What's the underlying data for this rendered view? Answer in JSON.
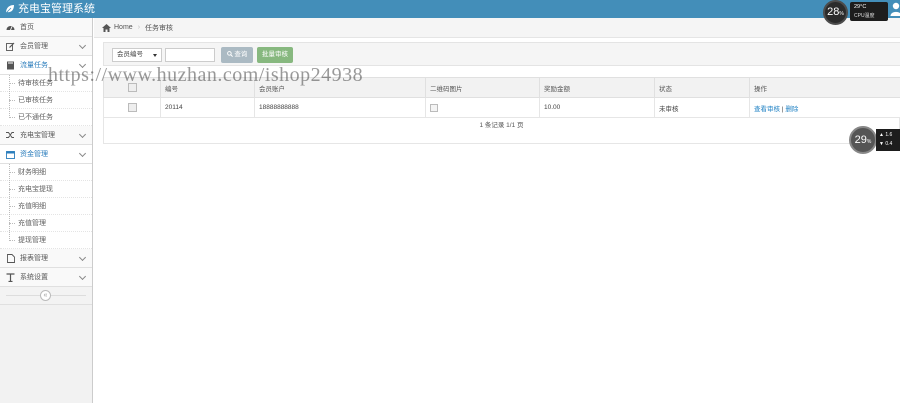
{
  "app": {
    "title": "充电宝管理系统"
  },
  "sidebar": {
    "items": [
      {
        "label": "首页",
        "icon": "tachometer-icon"
      },
      {
        "label": "会员管理",
        "icon": "edit-icon"
      },
      {
        "label": "流量任务",
        "icon": "book-icon"
      }
    ],
    "task_sub": [
      "待审核任务",
      "已审核任务",
      "已不通任务"
    ],
    "mid_items": [
      {
        "label": "充电宝管理",
        "icon": "shuffle-icon"
      },
      {
        "label": "资金管理",
        "icon": "calendar-icon"
      }
    ],
    "fund_sub": [
      "财务明细",
      "充电宝提现",
      "充值明细",
      "充值管理",
      "提现管理"
    ],
    "bottom_items": [
      {
        "label": "报表管理",
        "icon": "file-icon"
      },
      {
        "label": "系统设置",
        "icon": "text-icon"
      }
    ],
    "collapse_glyph": "«"
  },
  "breadcrumb": {
    "home": "Home",
    "current": "任务审核"
  },
  "search": {
    "select_value": "会员编号",
    "search_label": "查询",
    "audit_label": "批量审核"
  },
  "table": {
    "headers": [
      "",
      "编号",
      "会员账户",
      "二维码图片",
      "奖励金额",
      "状态",
      "操作"
    ],
    "rows": [
      {
        "id": "20114",
        "account": "18888888888",
        "amount": "10.00",
        "status": "未审核",
        "action_review": "查看审核",
        "action_sep": "|",
        "action_delete": "删除"
      }
    ],
    "pagination": "1 条记录 1/1 页"
  },
  "watermark": "https://www.huzhan.com/ishop24938",
  "monitor_top": {
    "percent": "28",
    "unit": "%",
    "temp": "29°C",
    "label": "CPU温度"
  },
  "monitor_side": {
    "percent": "29",
    "unit": "%",
    "row1": "1.6",
    "row2": "0.4"
  },
  "colors": {
    "navbar": "#438eb9",
    "link": "#2283c5",
    "audit_button": "#87b87f",
    "search_button": "#abbac3"
  }
}
